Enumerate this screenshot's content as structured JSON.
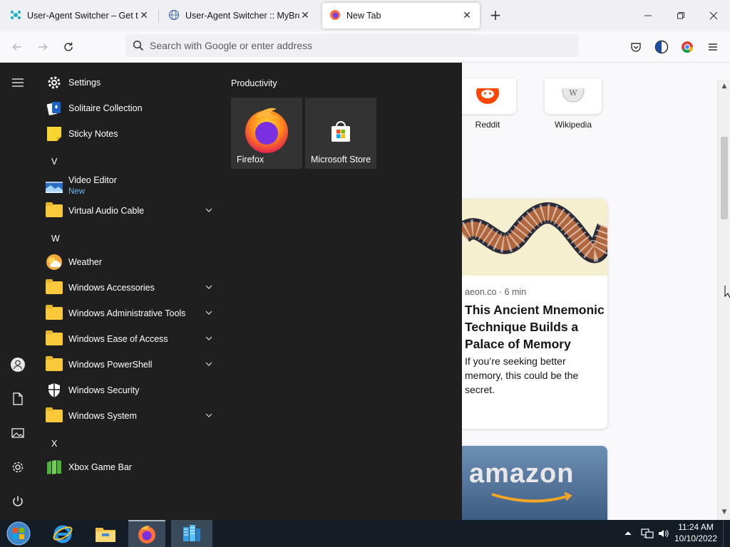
{
  "browser": {
    "tabs": [
      {
        "title": "User-Agent Switcher – Get this Extension"
      },
      {
        "title": "User-Agent Switcher :: MyBrowser"
      },
      {
        "title": "New Tab"
      }
    ],
    "new_tab_symbol": "+",
    "url_placeholder": "Search with Google or enter address"
  },
  "newtab": {
    "top_sites": [
      {
        "label": "Reddit"
      },
      {
        "label": "Wikipedia"
      }
    ],
    "stories": [
      {
        "source": "aeon.co · 6 min",
        "headline": "This Ancient Mnemonic Technique Builds a Palace of Memory",
        "excerpt": "If you’re seeking better memory, this could be the secret."
      },
      {
        "source": "",
        "headline": "",
        "excerpt": "",
        "image_text": "amazon"
      }
    ]
  },
  "start_menu": {
    "rail": [
      "hamburger-icon",
      "user-icon",
      "documents-icon",
      "pictures-icon",
      "settings-icon",
      "power-icon"
    ],
    "apps": [
      {
        "label": "Settings",
        "icon": "gear-icon"
      },
      {
        "label": "Solitaire Collection",
        "icon": "cards-icon"
      },
      {
        "label": "Sticky Notes",
        "icon": "sticky-note-icon"
      },
      {
        "letter": "V"
      },
      {
        "label": "Video Editor",
        "sub": "New",
        "icon": "video-editor-icon"
      },
      {
        "label": "Virtual Audio Cable",
        "icon": "folder-icon",
        "expand": true
      },
      {
        "letter": "W"
      },
      {
        "label": "Weather",
        "icon": "weather-icon"
      },
      {
        "label": "Windows Accessories",
        "icon": "folder-icon",
        "expand": true
      },
      {
        "label": "Windows Administrative Tools",
        "icon": "folder-icon",
        "expand": true
      },
      {
        "label": "Windows Ease of Access",
        "icon": "folder-icon",
        "expand": true
      },
      {
        "label": "Windows PowerShell",
        "icon": "folder-icon",
        "expand": true
      },
      {
        "label": "Windows Security",
        "icon": "shield-icon"
      },
      {
        "label": "Windows System",
        "icon": "folder-icon",
        "expand": true
      },
      {
        "letter": "X"
      },
      {
        "label": "Xbox Game Bar",
        "icon": "xbox-game-bar-icon"
      }
    ],
    "group": {
      "title": "Productivity",
      "tiles": [
        {
          "label": "Firefox",
          "icon": "firefox-icon"
        },
        {
          "label": "Microsoft Store",
          "icon": "store-icon"
        }
      ]
    }
  },
  "taskbar": {
    "items": [
      "start-orb-icon",
      "internet-explorer-icon",
      "file-explorer-icon",
      "firefox-icon",
      "app-icon"
    ],
    "active_index": 3,
    "clock": {
      "time": "11:24 AM",
      "date": "10/10/2022"
    }
  },
  "colors": {
    "start_bg": "#1f1f1f",
    "tile_bg": "#333333",
    "accent_sub": "#6cb8f6",
    "taskbar_bg": "#141c26"
  }
}
